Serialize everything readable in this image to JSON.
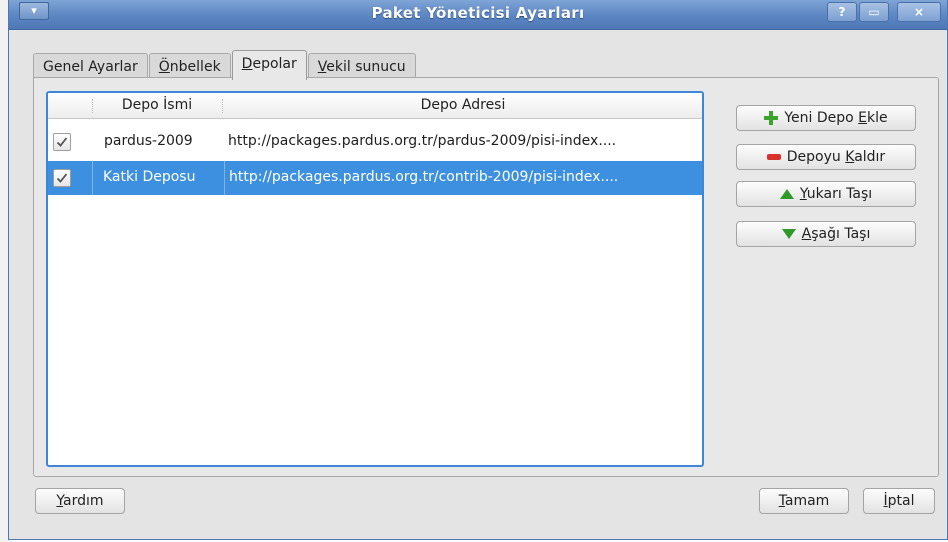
{
  "window": {
    "title": "Paket Yöneticisi Ayarları",
    "buttons": {
      "help": "?",
      "maximize": "▭",
      "close": "×"
    }
  },
  "tabs": [
    {
      "label": "Genel Ayarlar",
      "accel": "",
      "rest": "Genel Ayarlar",
      "active": false
    },
    {
      "label": "Önbellek",
      "accel": "Ö",
      "rest": "nbellek",
      "active": false
    },
    {
      "label": "Depolar",
      "accel": "D",
      "rest": "epolar",
      "active": true
    },
    {
      "label": "Vekil sunucu",
      "accel": "V",
      "rest": "ekil sunucu",
      "active": false
    }
  ],
  "repo_list": {
    "columns": {
      "name": "Depo İsmi",
      "address": "Depo Adresi"
    },
    "rows": [
      {
        "checked": true,
        "name": "pardus-2009",
        "address": "http://packages.pardus.org.tr/pardus-2009/pisi-index....",
        "selected": false
      },
      {
        "checked": true,
        "name": "Katki Deposu",
        "address": "http://packages.pardus.org.tr/contrib-2009/pisi-index....",
        "selected": true
      }
    ]
  },
  "actions": {
    "add": {
      "pre": "Yeni Depo ",
      "accel": "E",
      "post": "kle",
      "icon": "plus-icon",
      "color": "#3aa52a"
    },
    "remove": {
      "pre": "Depoyu ",
      "accel": "K",
      "post": "aldır",
      "icon": "minus-icon",
      "color": "#d8312b"
    },
    "move_up": {
      "pre": "",
      "accel": "Y",
      "post": "ukarı Taşı",
      "icon": "arrow-up-icon",
      "color": "#2f9a27"
    },
    "move_down": {
      "pre": "",
      "accel": "A",
      "post": "şağı Taşı",
      "icon": "arrow-down-icon",
      "color": "#2f9a27"
    }
  },
  "footer": {
    "help": {
      "accel": "Y",
      "post": "ardım"
    },
    "ok": {
      "accel": "T",
      "post": "amam"
    },
    "cancel": {
      "accel": "İ",
      "post": "ptal"
    }
  }
}
